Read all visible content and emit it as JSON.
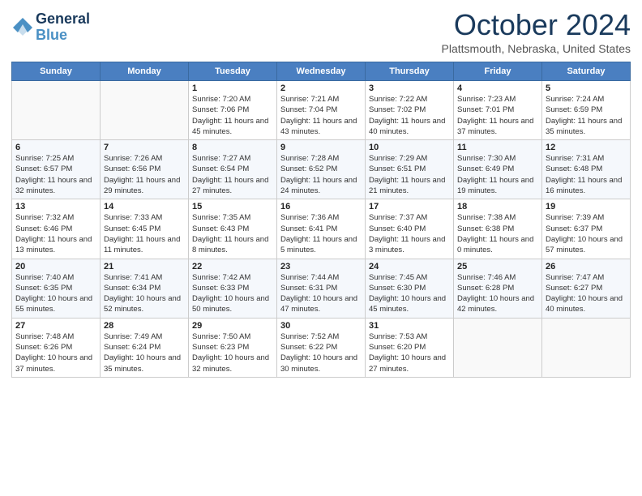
{
  "header": {
    "logo_line1": "General",
    "logo_line2": "Blue",
    "month": "October 2024",
    "location": "Plattsmouth, Nebraska, United States"
  },
  "days_of_week": [
    "Sunday",
    "Monday",
    "Tuesday",
    "Wednesday",
    "Thursday",
    "Friday",
    "Saturday"
  ],
  "weeks": [
    [
      {
        "day": "",
        "info": ""
      },
      {
        "day": "",
        "info": ""
      },
      {
        "day": "1",
        "info": "Sunrise: 7:20 AM\nSunset: 7:06 PM\nDaylight: 11 hours and 45 minutes."
      },
      {
        "day": "2",
        "info": "Sunrise: 7:21 AM\nSunset: 7:04 PM\nDaylight: 11 hours and 43 minutes."
      },
      {
        "day": "3",
        "info": "Sunrise: 7:22 AM\nSunset: 7:02 PM\nDaylight: 11 hours and 40 minutes."
      },
      {
        "day": "4",
        "info": "Sunrise: 7:23 AM\nSunset: 7:01 PM\nDaylight: 11 hours and 37 minutes."
      },
      {
        "day": "5",
        "info": "Sunrise: 7:24 AM\nSunset: 6:59 PM\nDaylight: 11 hours and 35 minutes."
      }
    ],
    [
      {
        "day": "6",
        "info": "Sunrise: 7:25 AM\nSunset: 6:57 PM\nDaylight: 11 hours and 32 minutes."
      },
      {
        "day": "7",
        "info": "Sunrise: 7:26 AM\nSunset: 6:56 PM\nDaylight: 11 hours and 29 minutes."
      },
      {
        "day": "8",
        "info": "Sunrise: 7:27 AM\nSunset: 6:54 PM\nDaylight: 11 hours and 27 minutes."
      },
      {
        "day": "9",
        "info": "Sunrise: 7:28 AM\nSunset: 6:52 PM\nDaylight: 11 hours and 24 minutes."
      },
      {
        "day": "10",
        "info": "Sunrise: 7:29 AM\nSunset: 6:51 PM\nDaylight: 11 hours and 21 minutes."
      },
      {
        "day": "11",
        "info": "Sunrise: 7:30 AM\nSunset: 6:49 PM\nDaylight: 11 hours and 19 minutes."
      },
      {
        "day": "12",
        "info": "Sunrise: 7:31 AM\nSunset: 6:48 PM\nDaylight: 11 hours and 16 minutes."
      }
    ],
    [
      {
        "day": "13",
        "info": "Sunrise: 7:32 AM\nSunset: 6:46 PM\nDaylight: 11 hours and 13 minutes."
      },
      {
        "day": "14",
        "info": "Sunrise: 7:33 AM\nSunset: 6:45 PM\nDaylight: 11 hours and 11 minutes."
      },
      {
        "day": "15",
        "info": "Sunrise: 7:35 AM\nSunset: 6:43 PM\nDaylight: 11 hours and 8 minutes."
      },
      {
        "day": "16",
        "info": "Sunrise: 7:36 AM\nSunset: 6:41 PM\nDaylight: 11 hours and 5 minutes."
      },
      {
        "day": "17",
        "info": "Sunrise: 7:37 AM\nSunset: 6:40 PM\nDaylight: 11 hours and 3 minutes."
      },
      {
        "day": "18",
        "info": "Sunrise: 7:38 AM\nSunset: 6:38 PM\nDaylight: 11 hours and 0 minutes."
      },
      {
        "day": "19",
        "info": "Sunrise: 7:39 AM\nSunset: 6:37 PM\nDaylight: 10 hours and 57 minutes."
      }
    ],
    [
      {
        "day": "20",
        "info": "Sunrise: 7:40 AM\nSunset: 6:35 PM\nDaylight: 10 hours and 55 minutes."
      },
      {
        "day": "21",
        "info": "Sunrise: 7:41 AM\nSunset: 6:34 PM\nDaylight: 10 hours and 52 minutes."
      },
      {
        "day": "22",
        "info": "Sunrise: 7:42 AM\nSunset: 6:33 PM\nDaylight: 10 hours and 50 minutes."
      },
      {
        "day": "23",
        "info": "Sunrise: 7:44 AM\nSunset: 6:31 PM\nDaylight: 10 hours and 47 minutes."
      },
      {
        "day": "24",
        "info": "Sunrise: 7:45 AM\nSunset: 6:30 PM\nDaylight: 10 hours and 45 minutes."
      },
      {
        "day": "25",
        "info": "Sunrise: 7:46 AM\nSunset: 6:28 PM\nDaylight: 10 hours and 42 minutes."
      },
      {
        "day": "26",
        "info": "Sunrise: 7:47 AM\nSunset: 6:27 PM\nDaylight: 10 hours and 40 minutes."
      }
    ],
    [
      {
        "day": "27",
        "info": "Sunrise: 7:48 AM\nSunset: 6:26 PM\nDaylight: 10 hours and 37 minutes."
      },
      {
        "day": "28",
        "info": "Sunrise: 7:49 AM\nSunset: 6:24 PM\nDaylight: 10 hours and 35 minutes."
      },
      {
        "day": "29",
        "info": "Sunrise: 7:50 AM\nSunset: 6:23 PM\nDaylight: 10 hours and 32 minutes."
      },
      {
        "day": "30",
        "info": "Sunrise: 7:52 AM\nSunset: 6:22 PM\nDaylight: 10 hours and 30 minutes."
      },
      {
        "day": "31",
        "info": "Sunrise: 7:53 AM\nSunset: 6:20 PM\nDaylight: 10 hours and 27 minutes."
      },
      {
        "day": "",
        "info": ""
      },
      {
        "day": "",
        "info": ""
      }
    ]
  ]
}
